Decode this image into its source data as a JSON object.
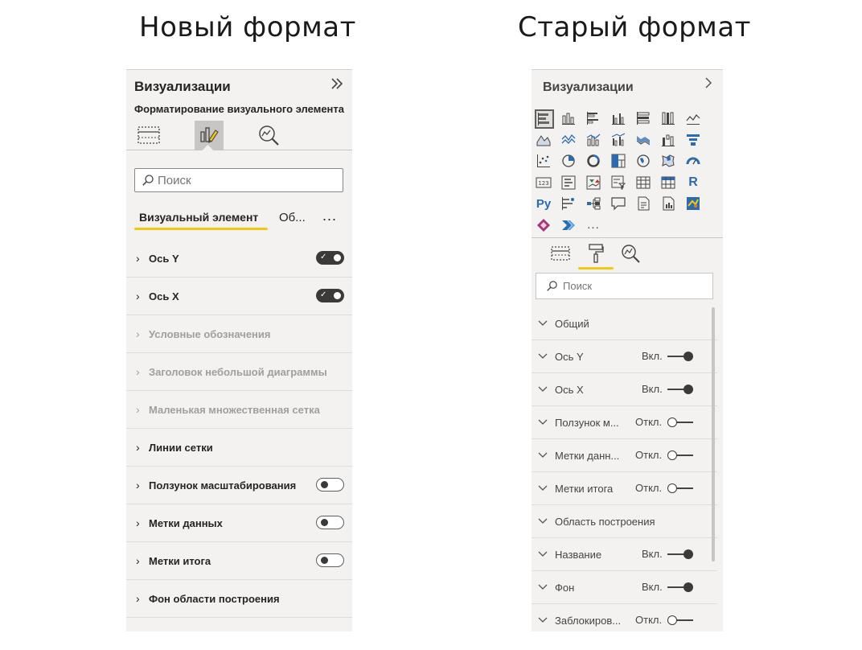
{
  "headings": {
    "new": "Новый формат",
    "old": "Старый формат"
  },
  "new_panel": {
    "title": "Визуализации",
    "collapse_icon": "double-chevron-right-icon",
    "subtitle": "Форматирование визуального элемента",
    "pane_icons": [
      "fields-icon",
      "format-visual-icon",
      "analytics-icon"
    ],
    "active_pane": "format-visual-icon",
    "search": {
      "placeholder": "Поиск",
      "value": ""
    },
    "tabs": {
      "active": "Визуальный элемент",
      "second": "Об...",
      "more": "..."
    },
    "sections": [
      {
        "label": "Ось Y",
        "enabled": true,
        "toggle": "on"
      },
      {
        "label": "Ось X",
        "enabled": true,
        "toggle": "on"
      },
      {
        "label": "Условные обозначения",
        "enabled": false,
        "toggle": null
      },
      {
        "label": "Заголовок небольшой диаграммы",
        "enabled": false,
        "toggle": null
      },
      {
        "label": "Маленькая множественная сетка",
        "enabled": false,
        "toggle": null
      },
      {
        "label": "Линии сетки",
        "enabled": true,
        "toggle": null
      },
      {
        "label": "Ползунок масштабирования",
        "enabled": true,
        "toggle": "off"
      },
      {
        "label": "Метки данных",
        "enabled": true,
        "toggle": "off"
      },
      {
        "label": "Метки итога",
        "enabled": true,
        "toggle": "off"
      },
      {
        "label": "Фон области построения",
        "enabled": true,
        "toggle": null
      }
    ]
  },
  "old_panel": {
    "title": "Визуализации",
    "collapse_icon": "chevron-right-icon",
    "visuals": [
      "stacked-bar-chart-icon",
      "stacked-column-chart-icon",
      "clustered-bar-chart-icon",
      "clustered-column-chart-icon",
      "100-stacked-bar-chart-icon",
      "100-stacked-column-chart-icon",
      "line-chart-icon",
      "area-chart-icon",
      "stacked-area-chart-icon",
      "line-and-stacked-column-icon",
      "line-and-clustered-column-icon",
      "ribbon-chart-icon",
      "waterfall-chart-icon",
      "funnel-chart-icon",
      "scatter-chart-icon",
      "pie-chart-icon",
      "donut-chart-icon",
      "treemap-icon",
      "map-icon",
      "filled-map-icon",
      "gauge-icon",
      "card-icon",
      "multi-row-card-icon",
      "kpi-icon",
      "slicer-icon",
      "table-icon",
      "matrix-icon",
      "r-visual-icon",
      "python-visual-icon",
      "key-influencers-icon",
      "decomposition-tree-icon",
      "qa-icon",
      "smart-narrative-icon",
      "paginated-report-icon",
      "arcgis-map-icon",
      "power-apps-icon",
      "power-automate-icon",
      "more-visuals-icon"
    ],
    "r_label": "R",
    "py_label": "Py",
    "card_label": "123",
    "more_label": "...",
    "pane_icons": [
      "fields-icon",
      "format-paint-roller-icon",
      "analytics-icon"
    ],
    "active_pane": "format-paint-roller-icon",
    "search": {
      "placeholder": "Поиск",
      "value": ""
    },
    "sections": [
      {
        "label": "Общий",
        "state": null,
        "toggle": null
      },
      {
        "label": "Ось Y",
        "state": "Вкл.",
        "toggle": "on"
      },
      {
        "label": "Ось X",
        "state": "Вкл.",
        "toggle": "on"
      },
      {
        "label": "Ползунок м...",
        "state": "Откл.",
        "toggle": "off"
      },
      {
        "label": "Метки данн...",
        "state": "Откл.",
        "toggle": "off"
      },
      {
        "label": "Метки итога",
        "state": "Откл.",
        "toggle": "off"
      },
      {
        "label": "Область построения",
        "state": null,
        "toggle": null
      },
      {
        "label": "Название",
        "state": "Вкл.",
        "toggle": "on"
      },
      {
        "label": "Фон",
        "state": "Вкл.",
        "toggle": "on"
      },
      {
        "label": "Заблокиров...",
        "state": "Откл.",
        "toggle": "off"
      }
    ]
  },
  "colors": {
    "accent_yellow": "#f2c811",
    "panel_bg": "#f3f2f1",
    "toggle_dark": "#3b3a39",
    "disabled_text": "#a19f9d"
  }
}
